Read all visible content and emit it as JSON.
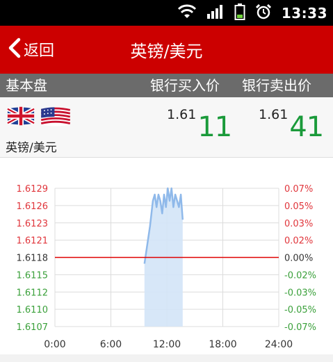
{
  "status_bar": {
    "time": "13:33",
    "icons": [
      "wifi-icon",
      "signal-icon",
      "battery-icon",
      "alarm-icon"
    ]
  },
  "app_bar": {
    "back_label": "返回",
    "title": "英镑/美元",
    "background": "#cc0000"
  },
  "table_header": {
    "base": "基本盘",
    "bank_buy": "银行买入价",
    "bank_sell": "银行卖出价"
  },
  "quote": {
    "pair": "英镑/美元",
    "flags": [
      "uk-flag-icon",
      "us-flag-icon"
    ],
    "buy_prefix": "1.61",
    "buy_suffix": "11",
    "sell_prefix": "1.61",
    "sell_suffix": "41",
    "accent": "#1a9a3a"
  },
  "chart_data": {
    "type": "area",
    "x_ticks": [
      "0:00",
      "6:00",
      "12:00",
      "18:00",
      "24:00"
    ],
    "xlim": [
      0,
      24
    ],
    "ylim": [
      1.6107,
      1.6129
    ],
    "left_ticks": [
      "1.6129",
      "1.6126",
      "1.6123",
      "1.6121",
      "1.6118",
      "1.6115",
      "1.6112",
      "1.6110",
      "1.6107"
    ],
    "right_ticks": [
      "0.07%",
      "0.05%",
      "0.03%",
      "0.02%",
      "0.00%",
      "-0.02%",
      "-0.03%",
      "-0.05%",
      "-0.07%"
    ],
    "reference_value": 1.6118,
    "series": [
      {
        "x": [
          9.6,
          9.9,
          10.2,
          10.5,
          10.7,
          10.9,
          11.1,
          11.3,
          11.5,
          11.7,
          11.9,
          12.1,
          12.3,
          12.5,
          12.7,
          12.9,
          13.1,
          13.3,
          13.5,
          13.7
        ],
        "y": [
          1.6117,
          1.612,
          1.6123,
          1.6127,
          1.6128,
          1.6126,
          1.6128,
          1.6127,
          1.6125,
          1.6128,
          1.6126,
          1.6129,
          1.6127,
          1.6129,
          1.6126,
          1.6128,
          1.6127,
          1.6126,
          1.6128,
          1.6124
        ]
      }
    ],
    "colors": {
      "up_label": "#e0353b",
      "down_label": "#3aa03a",
      "reference_line": "#e00000",
      "line": "#8fb9ea",
      "fill": "#d3e4f7",
      "grid": "#dcdcdc"
    },
    "grid": true
  }
}
